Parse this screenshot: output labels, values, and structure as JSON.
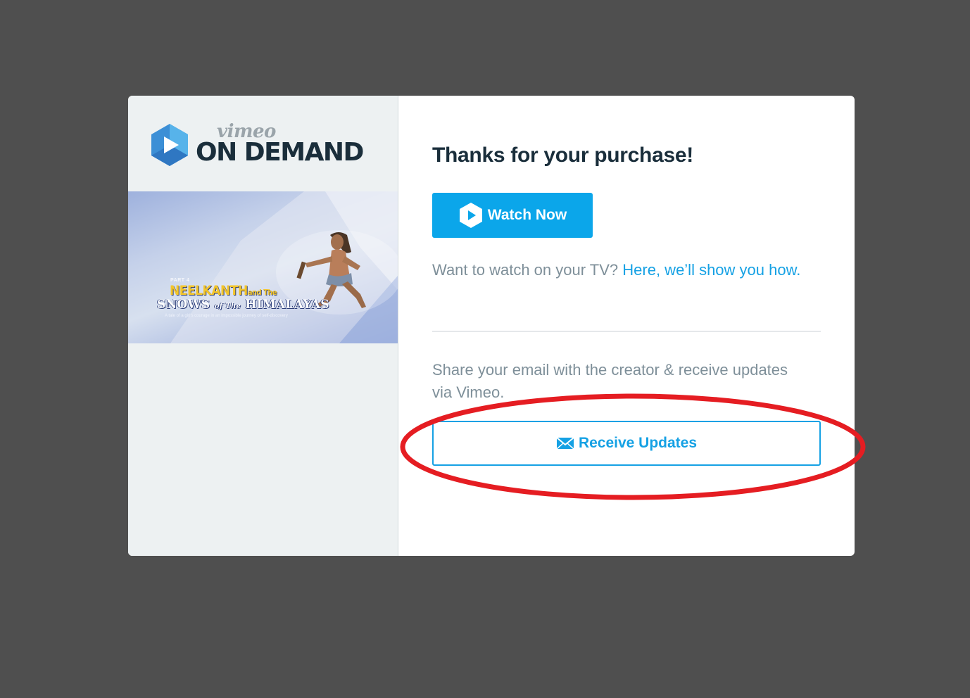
{
  "brand": {
    "vimeo": "vimeo",
    "on_demand": "ON DEMAND",
    "icon": "vimeo-on-demand-play-hexagon-icon"
  },
  "poster": {
    "part": "PART 4",
    "title_line1_main": "NEELKANTH",
    "title_line1_small": "and The",
    "title_line2_a": "SNOWS",
    "title_line2_small": "of The",
    "title_line2_b": "HIMALAYAS",
    "tagline": "A tale of a girl's courage in an impossible journey of self-discovery"
  },
  "main": {
    "heading": "Thanks for your purchase!",
    "watch_button": "Watch Now",
    "watch_icon": "play-hexagon-icon",
    "tv_prompt": "Want to watch on your TV?",
    "tv_link": "Here, we’ll show you how.",
    "share_text": "Share your email with the creator & receive updates via Vimeo.",
    "updates_button": "Receive Updates",
    "updates_icon": "envelope-icon"
  },
  "colors": {
    "backdrop": "#4f4f4f",
    "accent": "#0ba6ea",
    "heading": "#1a2e3b",
    "muted": "#7e8f99",
    "annotation": "#e51d22"
  }
}
